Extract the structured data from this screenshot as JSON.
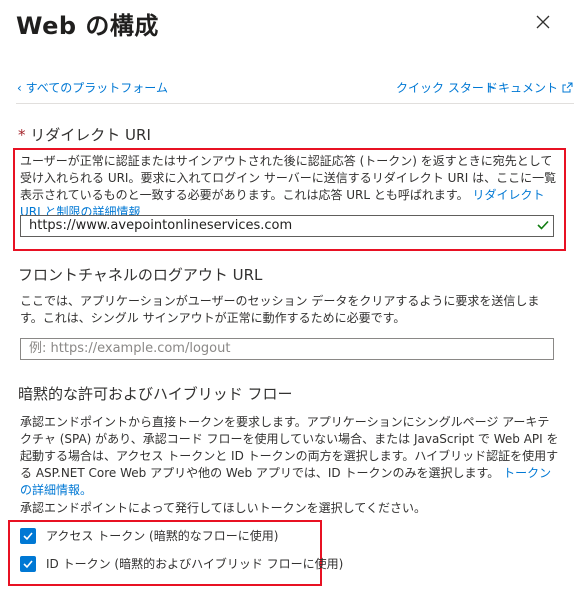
{
  "header": {
    "title": "Web の構成"
  },
  "nav": {
    "back_label": "すべてのプラットフォーム",
    "quickstart_label": "クイック スタート",
    "docs_label": "ドキュメント"
  },
  "redirect": {
    "heading": "リダイレクト URI",
    "required_mark": "*",
    "description": "ユーザーが正常に認証またはサインアウトされた後に認証応答 (トークン) を返すときに宛先として受け入れられる URI。要求に入れてログイン サーバーに送信するリダイレクト URI は、ここに一覧表示されているものと一致する必要があります。これは応答 URL とも呼ばれます。",
    "link": "リダイレクト URI と制限の詳細情報",
    "value": "https://www.avepointonlineservices.com"
  },
  "logout": {
    "heading": "フロントチャネルのログアウト URL",
    "description": "ここでは、アプリケーションがユーザーのセッション データをクリアするように要求を送信します。これは、シングル サインアウトが正常に動作するために必要です。",
    "placeholder": "例: https://example.com/logout"
  },
  "implicit": {
    "heading": "暗黙的な許可およびハイブリッド フロー",
    "description": "承認エンドポイントから直接トークンを要求します。アプリケーションにシングルページ アーキテクチャ (SPA) があり、承認コード フローを使用していない場合、または JavaScript で Web API を起動する場合は、アクセス トークンと ID トークンの両方を選択します。ハイブリッド認証を使用する ASP.NET Core Web アプリや他の Web アプリでは、ID トークンのみを選択します。",
    "link": "トークンの詳細情報。",
    "select_prompt": "承認エンドポイントによって発行してほしいトークンを選択してください。",
    "options": [
      {
        "label": "アクセス トークン (暗黙的なフローに使用)",
        "checked": true
      },
      {
        "label": "ID トークン (暗黙的およびハイブリッド フローに使用)",
        "checked": true
      }
    ]
  },
  "colors": {
    "accent": "#0078d4",
    "highlight": "#e81123",
    "success": "#107c10"
  }
}
